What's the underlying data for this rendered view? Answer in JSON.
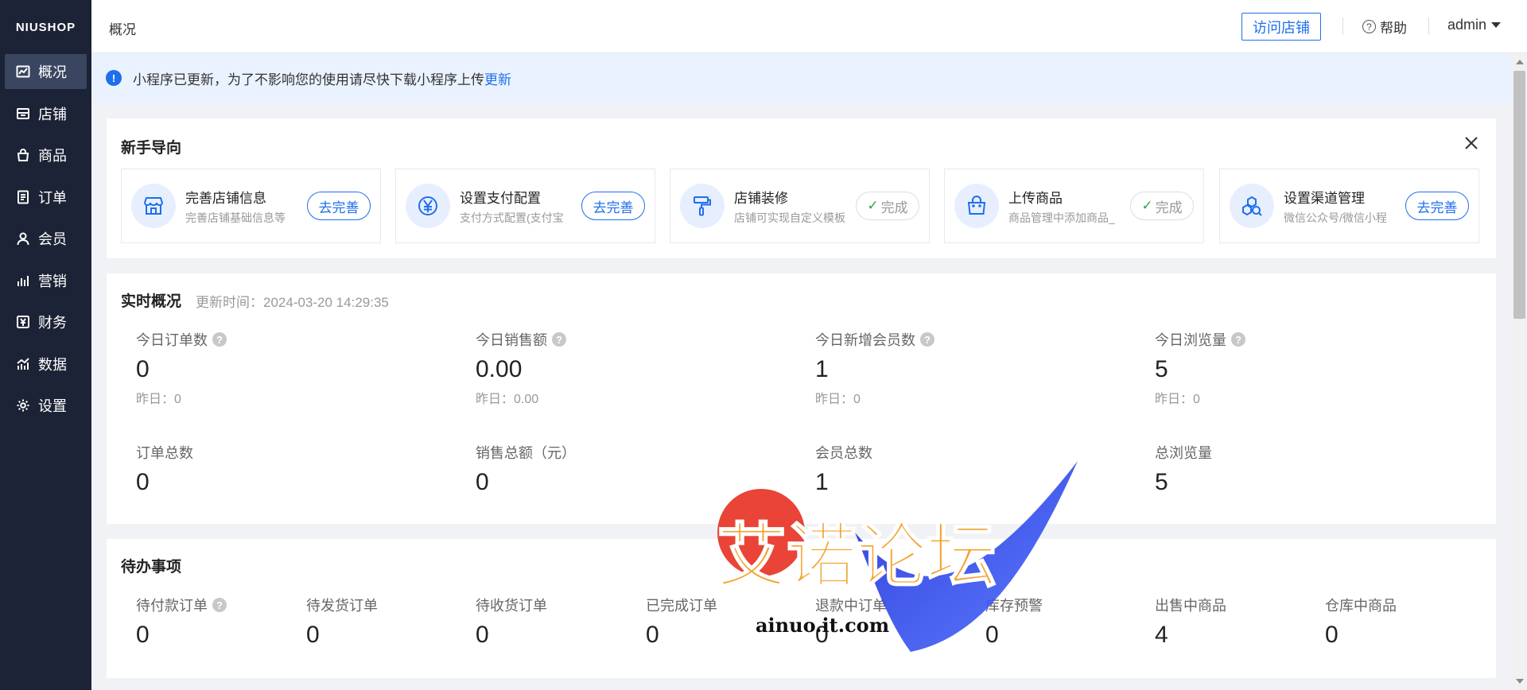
{
  "brand": "NIUSHOP",
  "sidebar": {
    "items": [
      {
        "label": "概况",
        "icon": "chart-line-icon",
        "active": true
      },
      {
        "label": "店铺",
        "icon": "store-icon"
      },
      {
        "label": "商品",
        "icon": "bag-icon"
      },
      {
        "label": "订单",
        "icon": "order-list-icon"
      },
      {
        "label": "会员",
        "icon": "user-icon"
      },
      {
        "label": "营销",
        "icon": "bar-chart-icon"
      },
      {
        "label": "财务",
        "icon": "yen-icon"
      },
      {
        "label": "数据",
        "icon": "data-chart-icon"
      },
      {
        "label": "设置",
        "icon": "gear-icon"
      }
    ]
  },
  "topbar": {
    "breadcrumb": "概况",
    "visit_store": "访问店铺",
    "help": "帮助",
    "user": "admin"
  },
  "notice": {
    "text": "小程序已更新，为了不影响您的使用请尽快下载小程序上传",
    "link": "更新"
  },
  "guide": {
    "title": "新手导向",
    "items": [
      {
        "title": "完善店铺信息",
        "desc": "完善店铺基础信息等",
        "action": "去完善",
        "done": false,
        "icon": "store-icon"
      },
      {
        "title": "设置支付配置",
        "desc": "支付方式配置(支付宝",
        "action": "去完善",
        "done": false,
        "icon": "yen-circle-icon"
      },
      {
        "title": "店铺装修",
        "desc": "店铺可实现自定义模板",
        "action": "完成",
        "done": true,
        "icon": "paint-roller-icon"
      },
      {
        "title": "上传商品",
        "desc": "商品管理中添加商品_",
        "action": "完成",
        "done": true,
        "icon": "shopping-bag-icon"
      },
      {
        "title": "设置渠道管理",
        "desc": "微信公众号/微信小程",
        "action": "去完善",
        "done": false,
        "icon": "channels-icon"
      }
    ]
  },
  "realtime": {
    "title": "实时概况",
    "updated": "更新时间：2024-03-20 14:29:35",
    "today": [
      {
        "label": "今日订单数",
        "value": "0",
        "yesterday": "昨日：0"
      },
      {
        "label": "今日销售额",
        "value": "0.00",
        "yesterday": "昨日：0.00"
      },
      {
        "label": "今日新增会员数",
        "value": "1",
        "yesterday": "昨日：0"
      },
      {
        "label": "今日浏览量",
        "value": "5",
        "yesterday": "昨日：0"
      }
    ],
    "totals": [
      {
        "label": "订单总数",
        "value": "0"
      },
      {
        "label": "销售总额（元）",
        "value": "0"
      },
      {
        "label": "会员总数",
        "value": "1"
      },
      {
        "label": "总浏览量",
        "value": "5"
      }
    ]
  },
  "todo": {
    "title": "待办事项",
    "items": [
      {
        "label": "待付款订单",
        "value": "0",
        "help": true
      },
      {
        "label": "待发货订单",
        "value": "0"
      },
      {
        "label": "待收货订单",
        "value": "0"
      },
      {
        "label": "已完成订单",
        "value": "0"
      },
      {
        "label": "退款中订单",
        "value": "0"
      },
      {
        "label": "库存预警",
        "value": "0"
      },
      {
        "label": "出售中商品",
        "value": "4"
      },
      {
        "label": "仓库中商品",
        "value": "0"
      }
    ]
  },
  "watermark": {
    "text": "艾诺论坛",
    "domain": "ainuo.it.com"
  },
  "colors": {
    "accent": "#1f6feb",
    "sidebar": "#1d2336",
    "done": "#2ea44f"
  }
}
